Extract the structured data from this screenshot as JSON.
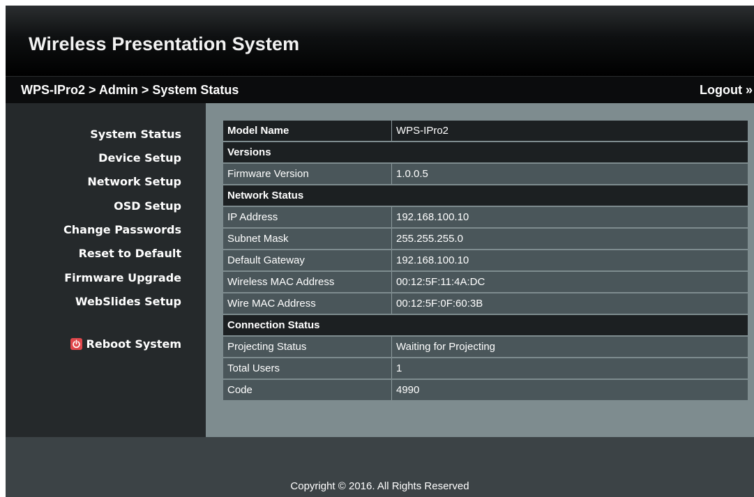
{
  "header": {
    "title": "Wireless Presentation System"
  },
  "nav": {
    "breadcrumb": "WPS-IPro2 > Admin > System Status",
    "logout_label": "Logout »"
  },
  "sidebar": {
    "items": [
      {
        "label": "System Status"
      },
      {
        "label": "Device Setup"
      },
      {
        "label": "Network Setup"
      },
      {
        "label": "OSD Setup"
      },
      {
        "label": "Change Passwords"
      },
      {
        "label": "Reset to Default"
      },
      {
        "label": "Firmware Upgrade"
      },
      {
        "label": "WebSlides Setup"
      }
    ],
    "reboot_label": "Reboot System",
    "reboot_icon": "power-icon"
  },
  "status": {
    "model_label": "Model Name",
    "model_value": "WPS-IPro2",
    "versions_header": "Versions",
    "firmware_label": "Firmware Version",
    "firmware_value": "1.0.0.5",
    "network_header": "Network Status",
    "ip_label": "IP Address",
    "ip_value": "192.168.100.10",
    "subnet_label": "Subnet Mask",
    "subnet_value": "255.255.255.0",
    "gateway_label": "Default Gateway",
    "gateway_value": "192.168.100.10",
    "wmac_label": "Wireless MAC Address",
    "wmac_value": "00:12:5F:11:4A:DC",
    "mac_label": "Wire MAC Address",
    "mac_value": "00:12:5F:0F:60:3B",
    "connection_header": "Connection Status",
    "projecting_label": "Projecting Status",
    "projecting_value": "Waiting for Projecting",
    "users_label": "Total Users",
    "users_value": "1",
    "code_label": "Code",
    "code_value": "4990"
  },
  "footer": {
    "copyright": "Copyright © 2016. All Rights Reserved"
  },
  "colors": {
    "banner": "#000000",
    "sidebar": "#25292b",
    "content": "#7e8c8f",
    "row": "#4a565a",
    "section": "#1c2022",
    "reboot_icon": "#e0474c"
  }
}
